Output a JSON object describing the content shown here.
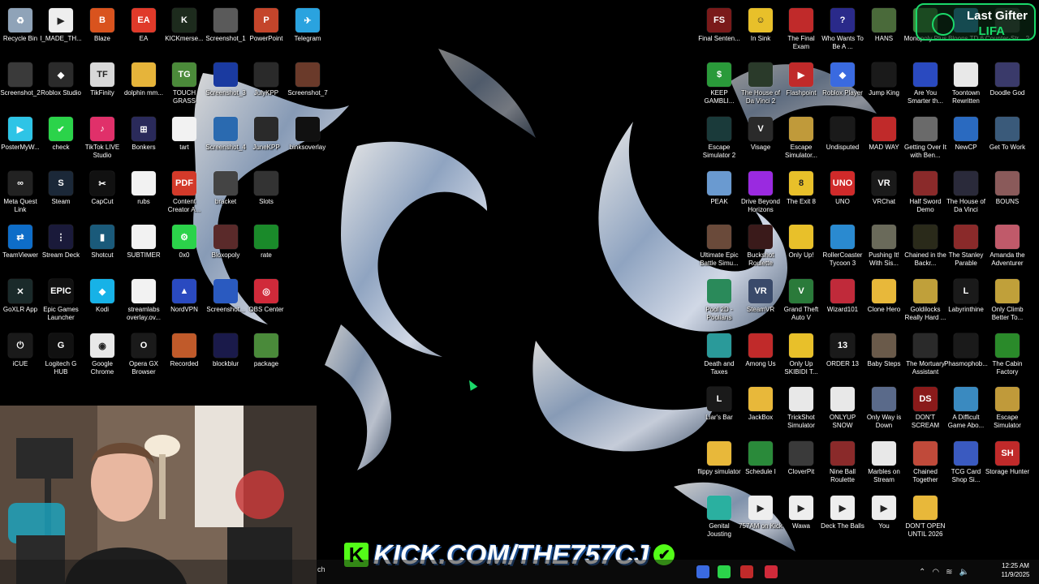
{
  "gifter": {
    "title": "Last Gifter",
    "name": "LIFA"
  },
  "banner": {
    "text": "KICK.COM/THE757CJ",
    "k": "K"
  },
  "clock": {
    "time": "12:25 AM",
    "date": "11/9/2025"
  },
  "taskbar": {
    "search_fragment": "ch"
  },
  "desktop_icons": [
    {
      "label": "Recycle Bin",
      "color": "#8fa3b8",
      "glyph": "♻"
    },
    {
      "label": "I_MADE_TH...",
      "color": "#eeeeee",
      "glyph": "▶"
    },
    {
      "label": "Blaze",
      "color": "#d9531e",
      "glyph": "B"
    },
    {
      "label": "EA",
      "color": "#e03a2a",
      "glyph": "EA"
    },
    {
      "label": "KICKmerse...",
      "color": "#1d2b1d",
      "glyph": "K"
    },
    {
      "label": "Screenshot_1",
      "color": "#5a5a5a",
      "glyph": ""
    },
    {
      "label": "PowerPoint",
      "color": "#c4452b",
      "glyph": "P"
    },
    {
      "label": "Telegram",
      "color": "#2aa3df",
      "glyph": "✈"
    },
    {
      "label": "Screenshot_2",
      "color": "#3a3a3a",
      "glyph": ""
    },
    {
      "label": "Roblox Studio",
      "color": "#2b2b2b",
      "glyph": "◆"
    },
    {
      "label": "TikFinity",
      "color": "#d8d8d8",
      "glyph": "TF"
    },
    {
      "label": "dolphin mm...",
      "color": "#e6b43a",
      "glyph": ""
    },
    {
      "label": "TOUCH GRASS",
      "color": "#4b8a3a",
      "glyph": "TG"
    },
    {
      "label": "Screenshot_3",
      "color": "#1a3aa0",
      "glyph": ""
    },
    {
      "label": "JulyKPP",
      "color": "#2a2a2a",
      "glyph": ""
    },
    {
      "label": "Screenshot_7",
      "color": "#6a3a2a",
      "glyph": ""
    },
    {
      "label": "PosterMyW...",
      "color": "#2ec4e6",
      "glyph": "▶"
    },
    {
      "label": "check",
      "color": "#2bd34a",
      "glyph": "✔"
    },
    {
      "label": "TikTok LIVE Studio",
      "color": "#e0306a",
      "glyph": "♪"
    },
    {
      "label": "Bonkers",
      "color": "#2a2a5a",
      "glyph": "⊞"
    },
    {
      "label": "tart",
      "color": "#f2f2f2",
      "glyph": ""
    },
    {
      "label": "Screenshot_4",
      "color": "#2a6ab0",
      "glyph": ""
    },
    {
      "label": "JuneKPP",
      "color": "#2a2a2a",
      "glyph": ""
    },
    {
      "label": "binksoverlay",
      "color": "#111111",
      "glyph": ""
    },
    {
      "label": "Meta Quest Link",
      "color": "#222222",
      "glyph": "∞"
    },
    {
      "label": "Steam",
      "color": "#1b2838",
      "glyph": "S"
    },
    {
      "label": "CapCut",
      "color": "#111111",
      "glyph": "✂"
    },
    {
      "label": "rubs",
      "color": "#f2f2f2",
      "glyph": ""
    },
    {
      "label": "Content Creator A...",
      "color": "#d33a2a",
      "glyph": "PDF"
    },
    {
      "label": "bracket",
      "color": "#444444",
      "glyph": ""
    },
    {
      "label": "Slots",
      "color": "#333333",
      "glyph": ""
    },
    {
      "label": "TeamViewer",
      "color": "#0e6dc8",
      "glyph": "⇄"
    },
    {
      "label": "Stream Deck",
      "color": "#1a1a3a",
      "glyph": "⋮"
    },
    {
      "label": "Shotcut",
      "color": "#1a5a7a",
      "glyph": "▮"
    },
    {
      "label": "SUBTIMER",
      "color": "#f2f2f2",
      "glyph": ""
    },
    {
      "label": "0x0",
      "color": "#2bd34a",
      "glyph": "⚙"
    },
    {
      "label": "Bloxopoly",
      "color": "#5a2a2a",
      "glyph": ""
    },
    {
      "label": "rate",
      "color": "#1a8a2a",
      "glyph": ""
    },
    {
      "label": "GoXLR App",
      "color": "#1a2a2a",
      "glyph": "✕"
    },
    {
      "label": "Epic Games Launcher",
      "color": "#111111",
      "glyph": "EPIC"
    },
    {
      "label": "Kodi",
      "color": "#17b2e7",
      "glyph": "◆"
    },
    {
      "label": "streamlabs overlay.ov...",
      "color": "#f2f2f2",
      "glyph": ""
    },
    {
      "label": "NordVPN",
      "color": "#2a4ac0",
      "glyph": "▲"
    },
    {
      "label": "Screenshot...",
      "color": "#2a5ac0",
      "glyph": ""
    },
    {
      "label": "OBS Center",
      "color": "#d02a3a",
      "glyph": "◎"
    },
    {
      "label": "iCUE",
      "color": "#1a1a1a",
      "glyph": "⏻"
    },
    {
      "label": "Logitech G HUB",
      "color": "#111111",
      "glyph": "G"
    },
    {
      "label": "Google Chrome",
      "color": "#e8e8e8",
      "glyph": "◉"
    },
    {
      "label": "Opera GX Browser",
      "color": "#1a1a1a",
      "glyph": "O"
    },
    {
      "label": "Recorded",
      "color": "#c05a2a",
      "glyph": ""
    },
    {
      "label": "blockblur",
      "color": "#1a1a4a",
      "glyph": ""
    },
    {
      "label": "package",
      "color": "#4a8a3a",
      "glyph": ""
    },
    {
      "label": "Final Senten...",
      "color": "#7a1a1a",
      "glyph": "FS"
    },
    {
      "label": "In Sink",
      "color": "#e8c02a",
      "glyph": "☺"
    },
    {
      "label": "The Final Exam",
      "color": "#c02a2a",
      "glyph": ""
    },
    {
      "label": "Who Wants To Be A ...",
      "color": "#2a2a8a",
      "glyph": "?"
    },
    {
      "label": "HANS",
      "color": "#4a6a3a",
      "glyph": ""
    },
    {
      "label": "Monopoly Plus",
      "color": "#3a8a3a",
      "glyph": ""
    },
    {
      "label": "Bloons TD 6",
      "color": "#2a8ac0",
      "glyph": ""
    },
    {
      "label": "Counter-Str... 2",
      "color": "#3a3a3a",
      "glyph": ""
    },
    {
      "label": "KEEP GAMBLI...",
      "color": "#2a9a3a",
      "glyph": "$"
    },
    {
      "label": "The House of Da Vinci 2",
      "color": "#2a3a2a",
      "glyph": ""
    },
    {
      "label": "Flashpoint",
      "color": "#c02a2a",
      "glyph": "▶"
    },
    {
      "label": "Roblox Player",
      "color": "#3a6ae0",
      "glyph": "◆"
    },
    {
      "label": "Jump King",
      "color": "#1a1a1a",
      "glyph": ""
    },
    {
      "label": "Are You Smarter th...",
      "color": "#2a4ac0",
      "glyph": ""
    },
    {
      "label": "Toontown Rewritten",
      "color": "#e8e8e8",
      "glyph": ""
    },
    {
      "label": "Doodle God",
      "color": "#3a3a6a",
      "glyph": ""
    },
    {
      "label": "Escape Simulator 2",
      "color": "#1a3a3a",
      "glyph": ""
    },
    {
      "label": "Visage",
      "color": "#2a2a2a",
      "glyph": "V"
    },
    {
      "label": "Escape Simulator...",
      "color": "#c09a3a",
      "glyph": ""
    },
    {
      "label": "Undisputed",
      "color": "#1a1a1a",
      "glyph": ""
    },
    {
      "label": "MAD WAY",
      "color": "#c02a2a",
      "glyph": ""
    },
    {
      "label": "Getting Over It with Ben...",
      "color": "#6a6a6a",
      "glyph": ""
    },
    {
      "label": "NewCP",
      "color": "#2a6ac0",
      "glyph": ""
    },
    {
      "label": "Get To Work",
      "color": "#3a5a7a",
      "glyph": ""
    },
    {
      "label": "PEAK",
      "color": "#6a9ad0",
      "glyph": ""
    },
    {
      "label": "Drive Beyond Horizons",
      "color": "#9a2ae0",
      "glyph": ""
    },
    {
      "label": "The Exit 8",
      "color": "#e8c02a",
      "glyph": "8"
    },
    {
      "label": "UNO",
      "color": "#d02a2a",
      "glyph": "UNO"
    },
    {
      "label": "VRChat",
      "color": "#1a1a1a",
      "glyph": "VR"
    },
    {
      "label": "Half Sword Demo",
      "color": "#8a2a2a",
      "glyph": ""
    },
    {
      "label": "The House of Da Vinci",
      "color": "#2a2a3a",
      "glyph": ""
    },
    {
      "label": "BOUNS",
      "color": "#8a5a5a",
      "glyph": ""
    },
    {
      "label": "Ultimate Epic Battle Simu...",
      "color": "#6a4a3a",
      "glyph": ""
    },
    {
      "label": "Buckshot Roulette",
      "color": "#3a1a1a",
      "glyph": ""
    },
    {
      "label": "Only Up!",
      "color": "#e8c02a",
      "glyph": ""
    },
    {
      "label": "RollerCoaster Tycoon 3",
      "color": "#2a8ad0",
      "glyph": ""
    },
    {
      "label": "Pushing It! With Sis...",
      "color": "#6a6a5a",
      "glyph": ""
    },
    {
      "label": "Chained in the Backr...",
      "color": "#2a2a1a",
      "glyph": ""
    },
    {
      "label": "The Stanley Parable",
      "color": "#8a2a2a",
      "glyph": ""
    },
    {
      "label": "Amanda the Adventurer",
      "color": "#c05a6a",
      "glyph": ""
    },
    {
      "label": "Pool 2D - Poolians",
      "color": "#2a8a5a",
      "glyph": ""
    },
    {
      "label": "SteamVR",
      "color": "#3a4a6a",
      "glyph": "VR"
    },
    {
      "label": "Grand Theft Auto V",
      "color": "#2a7a3a",
      "glyph": "V"
    },
    {
      "label": "Wizard101",
      "color": "#c02a3a",
      "glyph": ""
    },
    {
      "label": "Clone Hero",
      "color": "#e8b83a",
      "glyph": ""
    },
    {
      "label": "Goldilocks Really Hard ...",
      "color": "#c0a03a",
      "glyph": ""
    },
    {
      "label": "Labyrinthine",
      "color": "#1a1a1a",
      "glyph": "L"
    },
    {
      "label": "Only Climb Better To...",
      "color": "#c0a03a",
      "glyph": ""
    },
    {
      "label": "Death and Taxes",
      "color": "#2a9a9a",
      "glyph": ""
    },
    {
      "label": "Among Us",
      "color": "#c02a2a",
      "glyph": ""
    },
    {
      "label": "Only Up SKIBIDI T...",
      "color": "#e8c02a",
      "glyph": ""
    },
    {
      "label": "ORDER 13",
      "color": "#1a1a1a",
      "glyph": "13"
    },
    {
      "label": "Baby Steps",
      "color": "#6a5a4a",
      "glyph": ""
    },
    {
      "label": "The Mortuary Assistant",
      "color": "#2a2a2a",
      "glyph": ""
    },
    {
      "label": "Phasmophob...",
      "color": "#1a1a1a",
      "glyph": ""
    },
    {
      "label": "The Cabin Factory",
      "color": "#2a8a2a",
      "glyph": ""
    },
    {
      "label": "Liar's Bar",
      "color": "#1a1a1a",
      "glyph": "L"
    },
    {
      "label": "JackBox",
      "color": "#e8b83a",
      "glyph": ""
    },
    {
      "label": "TrickShot Simulator",
      "color": "#e8e8e8",
      "glyph": ""
    },
    {
      "label": "ONLYUP SNOW",
      "color": "#e8e8e8",
      "glyph": ""
    },
    {
      "label": "Only Way is Down",
      "color": "#5a6a8a",
      "glyph": ""
    },
    {
      "label": "DON'T SCREAM",
      "color": "#8a1a1a",
      "glyph": "DS"
    },
    {
      "label": "A Difficult Game Abo...",
      "color": "#3a8ac0",
      "glyph": ""
    },
    {
      "label": "Escape Simulator",
      "color": "#c09a3a",
      "glyph": ""
    },
    {
      "label": "flippy simulator",
      "color": "#e8b83a",
      "glyph": ""
    },
    {
      "label": "Schedule I",
      "color": "#2a8a3a",
      "glyph": ""
    },
    {
      "label": "CloverPit",
      "color": "#3a3a3a",
      "glyph": ""
    },
    {
      "label": "Nine Ball Roulette",
      "color": "#8a2a2a",
      "glyph": ""
    },
    {
      "label": "Marbles on Stream",
      "color": "#e8e8e8",
      "glyph": ""
    },
    {
      "label": "Chained Together",
      "color": "#c04a3a",
      "glyph": ""
    },
    {
      "label": "TCG Card Shop Si...",
      "color": "#3a5ac0",
      "glyph": ""
    },
    {
      "label": "Storage Hunter",
      "color": "#c02a2a",
      "glyph": "SH"
    },
    {
      "label": "Genital Jousting",
      "color": "#2ab0a0",
      "glyph": ""
    },
    {
      "label": "757AM on Kick",
      "color": "#eeeeee",
      "glyph": "▶"
    },
    {
      "label": "Wawa",
      "color": "#eeeeee",
      "glyph": "▶"
    },
    {
      "label": "Deck The Balls",
      "color": "#eeeeee",
      "glyph": "▶"
    },
    {
      "label": "You",
      "color": "#eeeeee",
      "glyph": "▶"
    },
    {
      "label": "DON'T OPEN UNTIL 2026",
      "color": "#e8b83a",
      "glyph": ""
    }
  ]
}
